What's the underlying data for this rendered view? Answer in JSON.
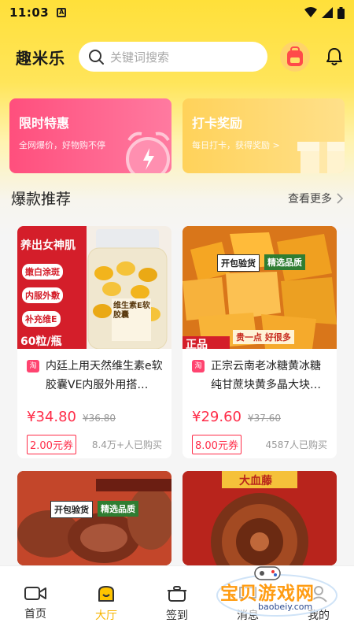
{
  "status_bar": {
    "time": "11:03"
  },
  "header": {
    "logo": "趣米乐",
    "search_placeholder": "关键词搜索"
  },
  "promos": [
    {
      "title": "限时特惠",
      "subtitle": "全网爆价，好物购不停"
    },
    {
      "title": "打卡奖励",
      "subtitle": "每日打卡，获得奖励 >"
    }
  ],
  "section": {
    "title": "爆款推荐",
    "more": "查看更多"
  },
  "products": [
    {
      "name": "内廷上用天然维生素e软胶囊VE内服外用搭…",
      "price": "¥34.80",
      "orig_price": "¥36.80",
      "coupon": "2.00元券",
      "sold": "8.4万+人已购买",
      "image_text": {
        "banner": "养出女神肌",
        "tags": [
          "嫩白涂斑",
          "内服外敷",
          "补充维E"
        ],
        "count": "60粒/瓶",
        "bottle": "维生素E软胶囊"
      }
    },
    {
      "name": "正宗云南老冰糖黄冰糖纯甘蔗块黄多晶大块…",
      "price": "¥29.60",
      "orig_price": "¥37.60",
      "coupon": "8.00元券",
      "sold": "4587人已购买",
      "image_text": {
        "badge1": "开包验货",
        "badge2": "精选品质",
        "bottom": "贵一点 好很多",
        "corner": "正品"
      }
    },
    {
      "image_text": {
        "badge1": "开包验货",
        "badge2": "精选品质"
      }
    },
    {
      "image_text": {
        "banner": "大血藤"
      }
    }
  ],
  "tabs": [
    {
      "label": "首页",
      "icon": "video-icon"
    },
    {
      "label": "大厅",
      "icon": "hall-icon"
    },
    {
      "label": "签到",
      "icon": "pot-icon"
    },
    {
      "label": "消息",
      "icon": "message-icon"
    },
    {
      "label": "我的",
      "icon": "profile-icon"
    }
  ],
  "watermark": {
    "text": "宝贝游戏网",
    "url": "baobeiy.com"
  },
  "colors": {
    "accent_yellow": "#ffe03a",
    "price_red": "#ff2c48",
    "promo_pink": "#ff4f7d",
    "promo_gold": "#ffd25a",
    "active_tab": "#f7b500"
  }
}
